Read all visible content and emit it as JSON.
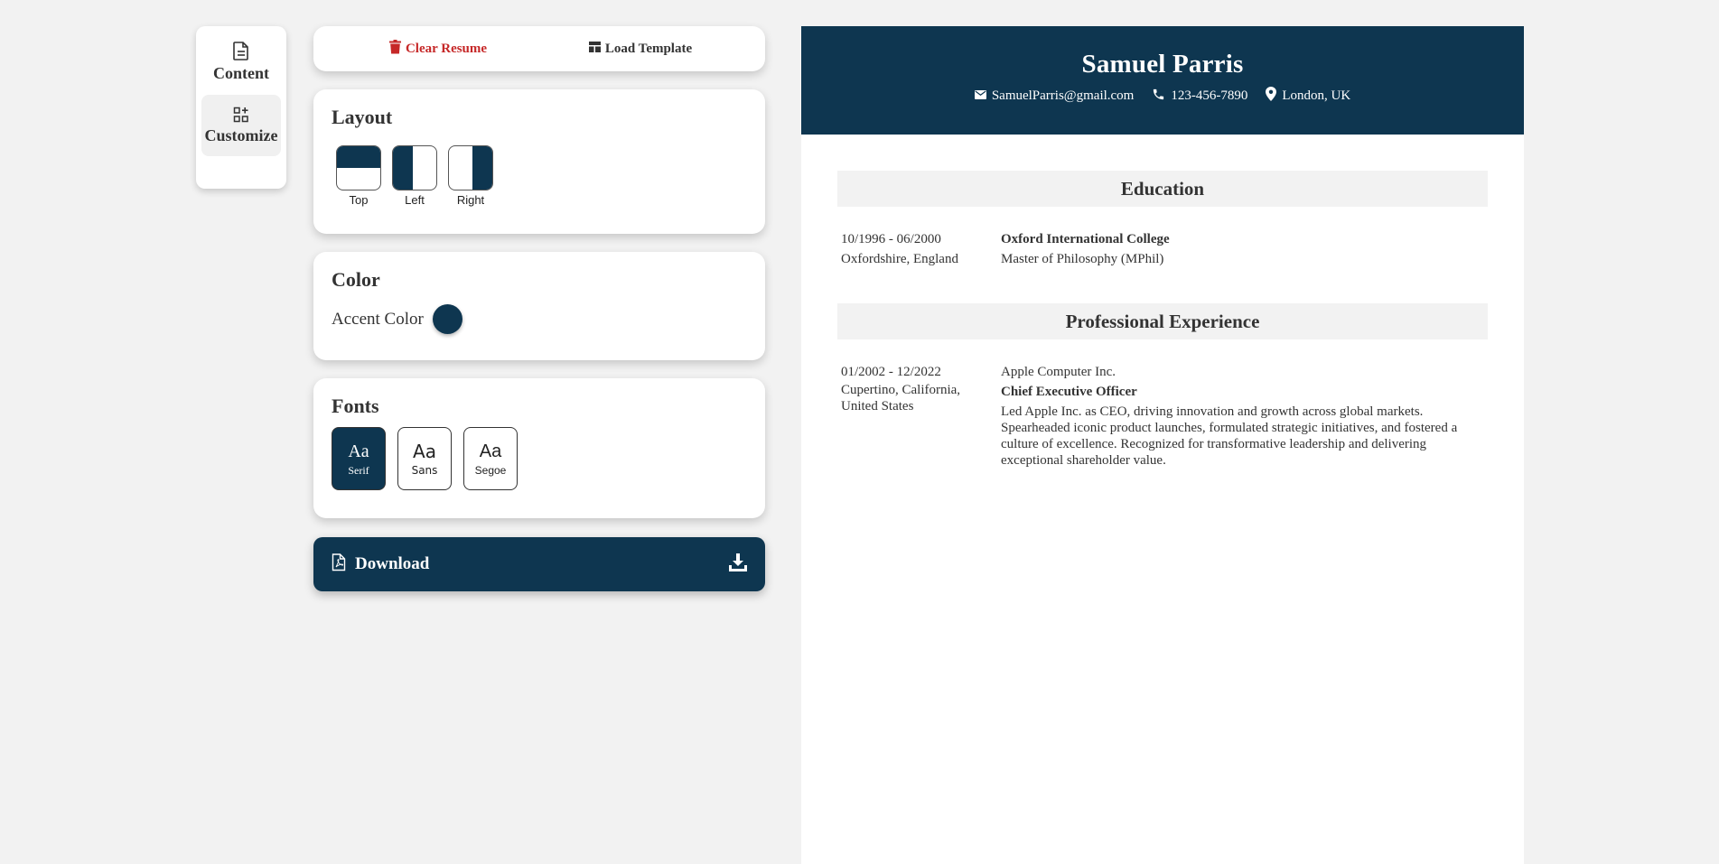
{
  "nav": {
    "items": [
      {
        "label": "Content",
        "icon": "document-icon",
        "active": false
      },
      {
        "label": "Customize",
        "icon": "widgets-icon",
        "active": true
      }
    ]
  },
  "toolbar": {
    "clear_label": "Clear Resume",
    "load_label": "Load Template"
  },
  "layout": {
    "title": "Layout",
    "options": [
      {
        "label": "Top",
        "selected": true
      },
      {
        "label": "Left",
        "selected": false
      },
      {
        "label": "Right",
        "selected": false
      }
    ]
  },
  "color": {
    "title": "Color",
    "accent_label": "Accent Color",
    "accent_value": "#0e3650"
  },
  "fonts": {
    "title": "Fonts",
    "options": [
      {
        "sample": "Aa",
        "label": "Serif",
        "selected": true
      },
      {
        "sample": "Aa",
        "label": "Sans",
        "selected": false
      },
      {
        "sample": "Aa",
        "label": "Segoe",
        "selected": false
      }
    ]
  },
  "download": {
    "label": "Download"
  },
  "resume": {
    "name": "Samuel Parris",
    "email": "SamuelParris@gmail.com",
    "phone": "123-456-7890",
    "location": "London, UK",
    "education": {
      "title": "Education",
      "entries": [
        {
          "dates": "10/1996 - 06/2000",
          "location": "Oxfordshire, England",
          "school": "Oxford International College",
          "degree": "Master of Philosophy (MPhil)"
        }
      ]
    },
    "experience": {
      "title": "Professional Experience",
      "entries": [
        {
          "dates": "01/2002 - 12/2022",
          "location": "Cupertino, California, United States",
          "company": "Apple Computer Inc.",
          "role": "Chief Executive Officer",
          "description": "Led Apple Inc. as CEO, driving innovation and growth across global markets. Spearheaded iconic product launches, formulated strategic initiatives, and fostered a culture of excellence. Recognized for transformative leadership and delivering exceptional shareholder value."
        }
      ]
    }
  },
  "colors": {
    "accent": "#0e3650",
    "danger": "#c62828",
    "background": "#f2f2f2"
  }
}
